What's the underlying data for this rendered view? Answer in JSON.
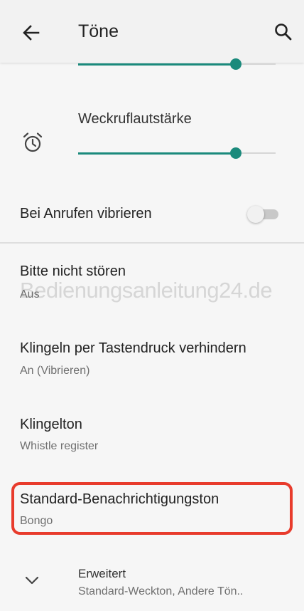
{
  "app_bar": {
    "title": "Töne",
    "back_icon": "arrow-back-icon",
    "search_icon": "search-icon"
  },
  "volume": {
    "previous_slider_level": 0.8,
    "alarm_label": "Weckruflautstärke",
    "alarm_icon": "alarm-clock-icon",
    "alarm_level": 0.8
  },
  "vibrate_on_call": {
    "label": "Bei Anrufen vibrieren",
    "enabled": false
  },
  "items": [
    {
      "title": "Bitte nicht stören",
      "subtitle": "Aus"
    },
    {
      "title": "Klingeln per Tastendruck verhindern",
      "subtitle": "An (Vibrieren)"
    },
    {
      "title": "Klingelton",
      "subtitle": "Whistle register"
    },
    {
      "title": "Standard-Benachrichtigungston",
      "subtitle": "Bongo"
    }
  ],
  "advanced": {
    "title": "Erweitert",
    "subtitle": "Standard-Weckton, Andere Tön..",
    "icon": "chevron-down-icon"
  },
  "watermark": "Bedienungsanleitung24.de",
  "colors": {
    "accent": "#1b8a7c",
    "highlight": "#e83b2c",
    "background": "#f6f6f6"
  }
}
